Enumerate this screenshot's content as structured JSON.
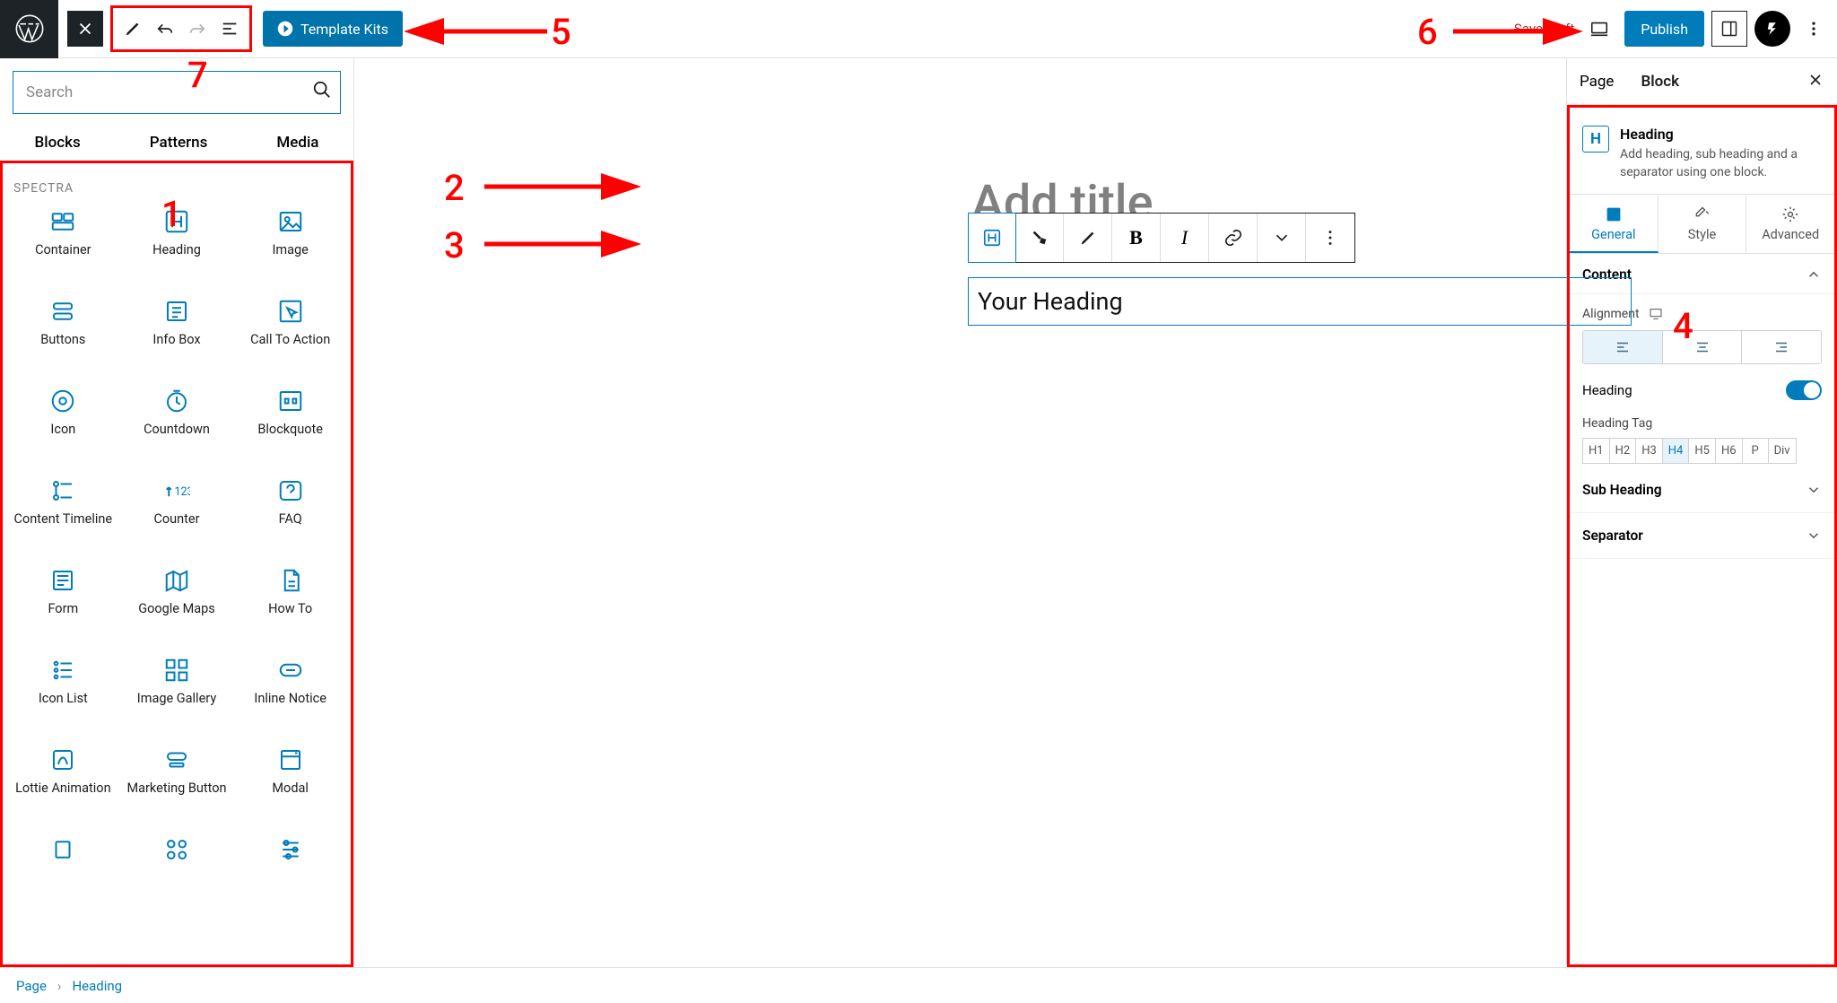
{
  "topbar": {
    "template_kits": "Template Kits",
    "save_draft": "Save draft",
    "publish": "Publish"
  },
  "inserter": {
    "search_placeholder": "Search",
    "tabs": {
      "blocks": "Blocks",
      "patterns": "Patterns",
      "media": "Media"
    },
    "section_label": "SPECTRA",
    "blocks": [
      {
        "label": "Container",
        "icon": "container"
      },
      {
        "label": "Heading",
        "icon": "heading"
      },
      {
        "label": "Image",
        "icon": "image"
      },
      {
        "label": "Buttons",
        "icon": "buttons"
      },
      {
        "label": "Info Box",
        "icon": "infobox"
      },
      {
        "label": "Call To Action",
        "icon": "cta"
      },
      {
        "label": "Icon",
        "icon": "icon"
      },
      {
        "label": "Countdown",
        "icon": "countdown"
      },
      {
        "label": "Blockquote",
        "icon": "blockquote"
      },
      {
        "label": "Content Timeline",
        "icon": "timeline"
      },
      {
        "label": "Counter",
        "icon": "counter"
      },
      {
        "label": "FAQ",
        "icon": "faq"
      },
      {
        "label": "Form",
        "icon": "form"
      },
      {
        "label": "Google Maps",
        "icon": "map"
      },
      {
        "label": "How To",
        "icon": "howto"
      },
      {
        "label": "Icon List",
        "icon": "iconlist"
      },
      {
        "label": "Image Gallery",
        "icon": "gallery"
      },
      {
        "label": "Inline Notice",
        "icon": "notice"
      },
      {
        "label": "Lottie Animation",
        "icon": "lottie"
      },
      {
        "label": "Marketing Button",
        "icon": "marketing"
      },
      {
        "label": "Modal",
        "icon": "modal"
      },
      {
        "label": "",
        "icon": "slider"
      },
      {
        "label": "",
        "icon": "grid4"
      },
      {
        "label": "",
        "icon": "sliders"
      }
    ]
  },
  "canvas": {
    "title_placeholder": "Add title",
    "heading_text": "Your Heading",
    "block_toolbar": {
      "bold": "B",
      "italic": "I"
    }
  },
  "sidebar": {
    "tabs": {
      "page": "Page",
      "block": "Block"
    },
    "block_card": {
      "title": "Heading",
      "desc": "Add heading, sub heading and a separator using one block."
    },
    "gsa": {
      "general": "General",
      "style": "Style",
      "advanced": "Advanced"
    },
    "content": {
      "header": "Content",
      "alignment_label": "Alignment",
      "heading_label": "Heading",
      "heading_tag_label": "Heading Tag",
      "tags": [
        "H1",
        "H2",
        "H3",
        "H4",
        "H5",
        "H6",
        "P",
        "Div"
      ],
      "active_tag": "H4"
    },
    "sub_heading_label": "Sub Heading",
    "separator_label": "Separator"
  },
  "breadcrumb": {
    "root": "Page",
    "current": "Heading"
  },
  "annotations": {
    "1": "1",
    "2": "2",
    "3": "3",
    "4": "4",
    "5": "5",
    "6": "6",
    "7": "7"
  }
}
